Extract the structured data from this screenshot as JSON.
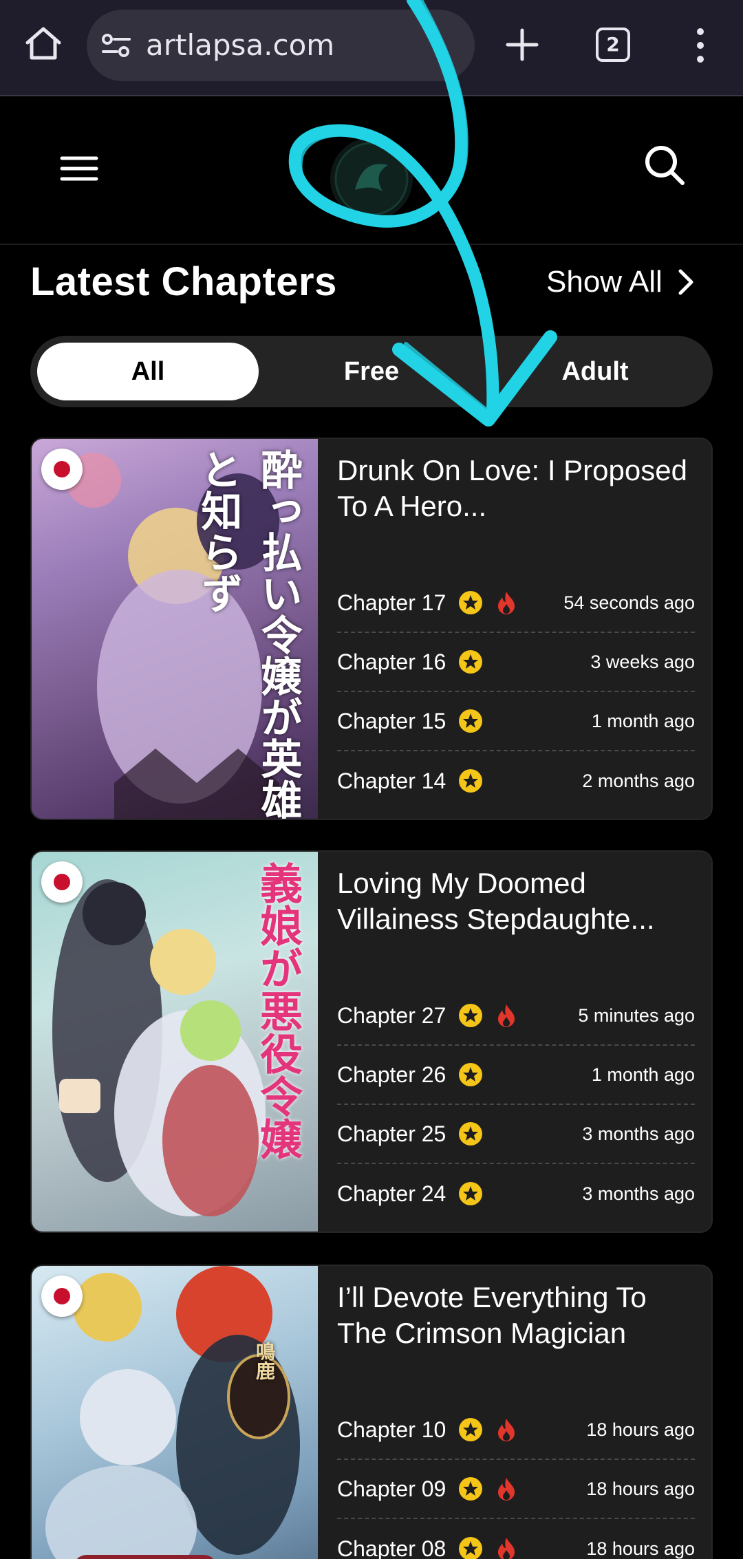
{
  "browser": {
    "url": "artlapsa.com",
    "tab_count": "2",
    "icons": [
      "home-icon",
      "site-settings-icon",
      "new-tab-icon",
      "tab-switcher-icon",
      "more-options-icon"
    ]
  },
  "site": {
    "icons": [
      "hamburger-menu-icon",
      "site-logo",
      "search-icon"
    ]
  },
  "section": {
    "title": "Latest Chapters",
    "show_all": "Show All"
  },
  "filters": [
    {
      "label": "All",
      "active": true
    },
    {
      "label": "Free",
      "active": false
    },
    {
      "label": "Adult",
      "active": false
    }
  ],
  "series": [
    {
      "title": "Drunk On Love: I Proposed To A Hero...",
      "cover_text": "酔っ払い令嬢が英雄と知らず",
      "chapters": [
        {
          "name": "Chapter 17",
          "time": "54 seconds ago",
          "hot": true
        },
        {
          "name": "Chapter 16",
          "time": "3 weeks ago",
          "hot": false
        },
        {
          "name": "Chapter 15",
          "time": "1 month ago",
          "hot": false
        },
        {
          "name": "Chapter 14",
          "time": "2 months ago",
          "hot": false
        }
      ]
    },
    {
      "title": "Loving My Doomed Villainess Stepdaughte...",
      "cover_text": "義娘が悪役令嬢",
      "chapters": [
        {
          "name": "Chapter 27",
          "time": "5 minutes ago",
          "hot": true
        },
        {
          "name": "Chapter 26",
          "time": "1 month ago",
          "hot": false
        },
        {
          "name": "Chapter 25",
          "time": "3 months ago",
          "hot": false
        },
        {
          "name": "Chapter 24",
          "time": "3 months ago",
          "hot": false
        }
      ]
    },
    {
      "title": "I’ll Devote Everything To The Crimson Magician",
      "cover_text": "鳴鹿",
      "chapters": [
        {
          "name": "Chapter 10",
          "time": "18 hours ago",
          "hot": true
        },
        {
          "name": "Chapter 09",
          "time": "18 hours ago",
          "hot": true
        },
        {
          "name": "Chapter 08",
          "time": "18 hours ago",
          "hot": true
        }
      ]
    }
  ],
  "colors": {
    "chrome_bg": "#1f1d2b",
    "page_bg": "#000000",
    "card_bg": "#1e1e1e",
    "star": "#f5c518",
    "fire": "#e0362c",
    "annotation": "#22d3e6"
  }
}
